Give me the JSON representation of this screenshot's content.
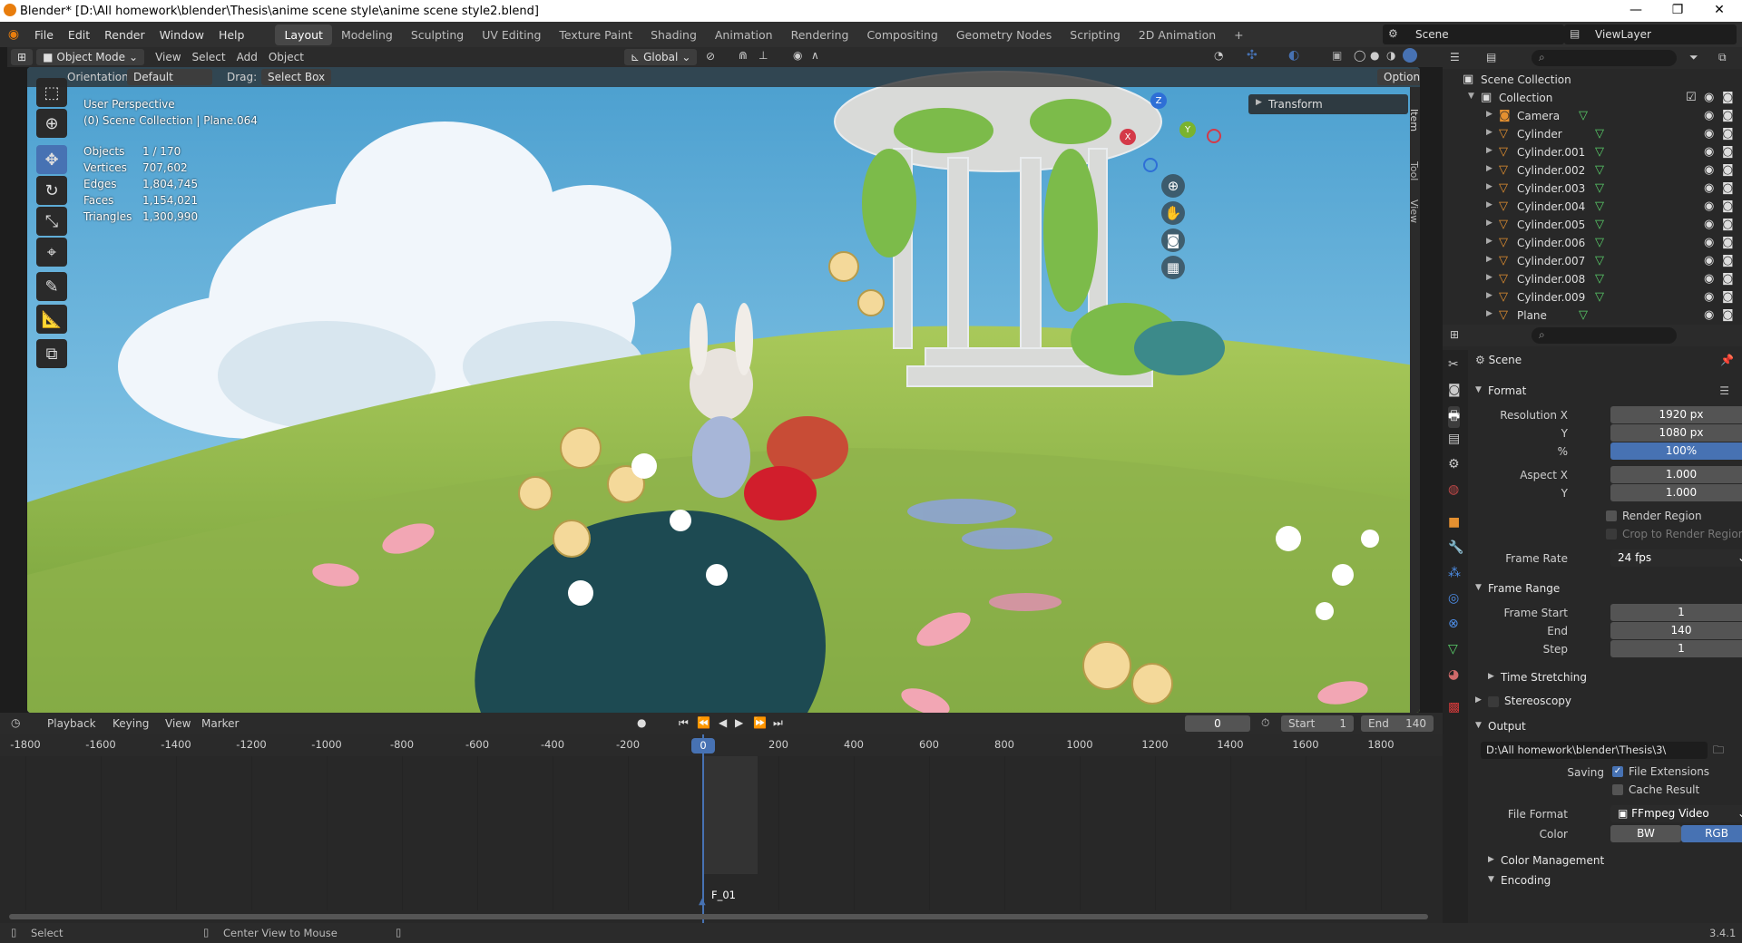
{
  "titlebar": {
    "title": "Blender* [D:\\All homework\\blender\\Thesis\\anime scene style\\anime scene style2.blend]",
    "minimize": "—",
    "maximize": "❐",
    "close": "✕"
  },
  "menu": [
    "File",
    "Edit",
    "Render",
    "Window",
    "Help"
  ],
  "workspaces": [
    "Layout",
    "Modeling",
    "Sculpting",
    "UV Editing",
    "Texture Paint",
    "Shading",
    "Animation",
    "Rendering",
    "Compositing",
    "Geometry Nodes",
    "Scripting",
    "2D Animation",
    "+"
  ],
  "scene": {
    "label": "Scene",
    "viewlayer": "ViewLayer"
  },
  "viewport_header": {
    "mode": "Object Mode",
    "menus": [
      "View",
      "Select",
      "Add",
      "Object"
    ],
    "transform_orientation": "Global"
  },
  "tool_settings": {
    "orientation_label": "Orientation:",
    "orientation_value": "Default",
    "drag_label": "Drag:",
    "drag_value": "Select Box",
    "options": "Options"
  },
  "viewport": {
    "perspective": "User Perspective",
    "collection": "(0) Scene Collection | Plane.064",
    "stats": [
      {
        "k": "Objects",
        "v": "1 / 170"
      },
      {
        "k": "Vertices",
        "v": "707,602"
      },
      {
        "k": "Edges",
        "v": "1,804,745"
      },
      {
        "k": "Faces",
        "v": "1,154,021"
      },
      {
        "k": "Triangles",
        "v": "1,300,990"
      }
    ],
    "n_panel_title": "Transform",
    "side_tabs": [
      "Item",
      "Tool",
      "View"
    ],
    "gizmo": {
      "x": "X",
      "y": "Y",
      "z": "Z"
    }
  },
  "outliner": {
    "root": "Scene Collection",
    "collection": "Collection",
    "items": [
      "Camera",
      "Cylinder",
      "Cylinder.001",
      "Cylinder.002",
      "Cylinder.003",
      "Cylinder.004",
      "Cylinder.005",
      "Cylinder.006",
      "Cylinder.007",
      "Cylinder.008",
      "Cylinder.009",
      "Plane"
    ]
  },
  "properties": {
    "context": "Scene",
    "format": {
      "title": "Format",
      "resolution_x_label": "Resolution X",
      "resolution_x": "1920 px",
      "resolution_y_label": "Y",
      "resolution_y": "1080 px",
      "percent_label": "%",
      "percent": "100%",
      "aspect_x_label": "Aspect X",
      "aspect_x": "1.000",
      "aspect_y_label": "Y",
      "aspect_y": "1.000",
      "render_region": "Render Region",
      "crop_region": "Crop to Render Region",
      "frame_rate_label": "Frame Rate",
      "frame_rate": "24 fps"
    },
    "frame_range": {
      "title": "Frame Range",
      "start_label": "Frame Start",
      "start": "1",
      "end_label": "End",
      "end": "140",
      "step_label": "Step",
      "step": "1",
      "time_stretching": "Time Stretching"
    },
    "stereoscopy": "Stereoscopy",
    "output": {
      "title": "Output",
      "path": "D:\\All homework\\blender\\Thesis\\3\\",
      "saving_label": "Saving",
      "file_extensions": "File Extensions",
      "cache_result": "Cache Result",
      "file_format_label": "File Format",
      "file_format": "FFmpeg Video",
      "color_label": "Color",
      "color_bw": "BW",
      "color_rgb": "RGB",
      "color_management": "Color Management",
      "encoding": "Encoding"
    }
  },
  "timeline": {
    "menus": [
      "Playback",
      "Keying",
      "View",
      "Marker"
    ],
    "current_frame": "0",
    "start_label": "Start",
    "start": "1",
    "end_label": "End",
    "end": "140",
    "ruler": [
      "-1800",
      "-1600",
      "-1400",
      "-1200",
      "-1000",
      "-800",
      "-600",
      "-400",
      "-200",
      "0",
      "200",
      "400",
      "600",
      "800",
      "1000",
      "1200",
      "1400",
      "1600",
      "1800"
    ],
    "playhead": "0",
    "marker": "F_01"
  },
  "statusbar": {
    "select": "Select",
    "center_view": "Center View to Mouse",
    "version": "3.4.1"
  },
  "colors": {
    "accent": "#4772b3",
    "bg": "#282828",
    "header": "#303030"
  }
}
